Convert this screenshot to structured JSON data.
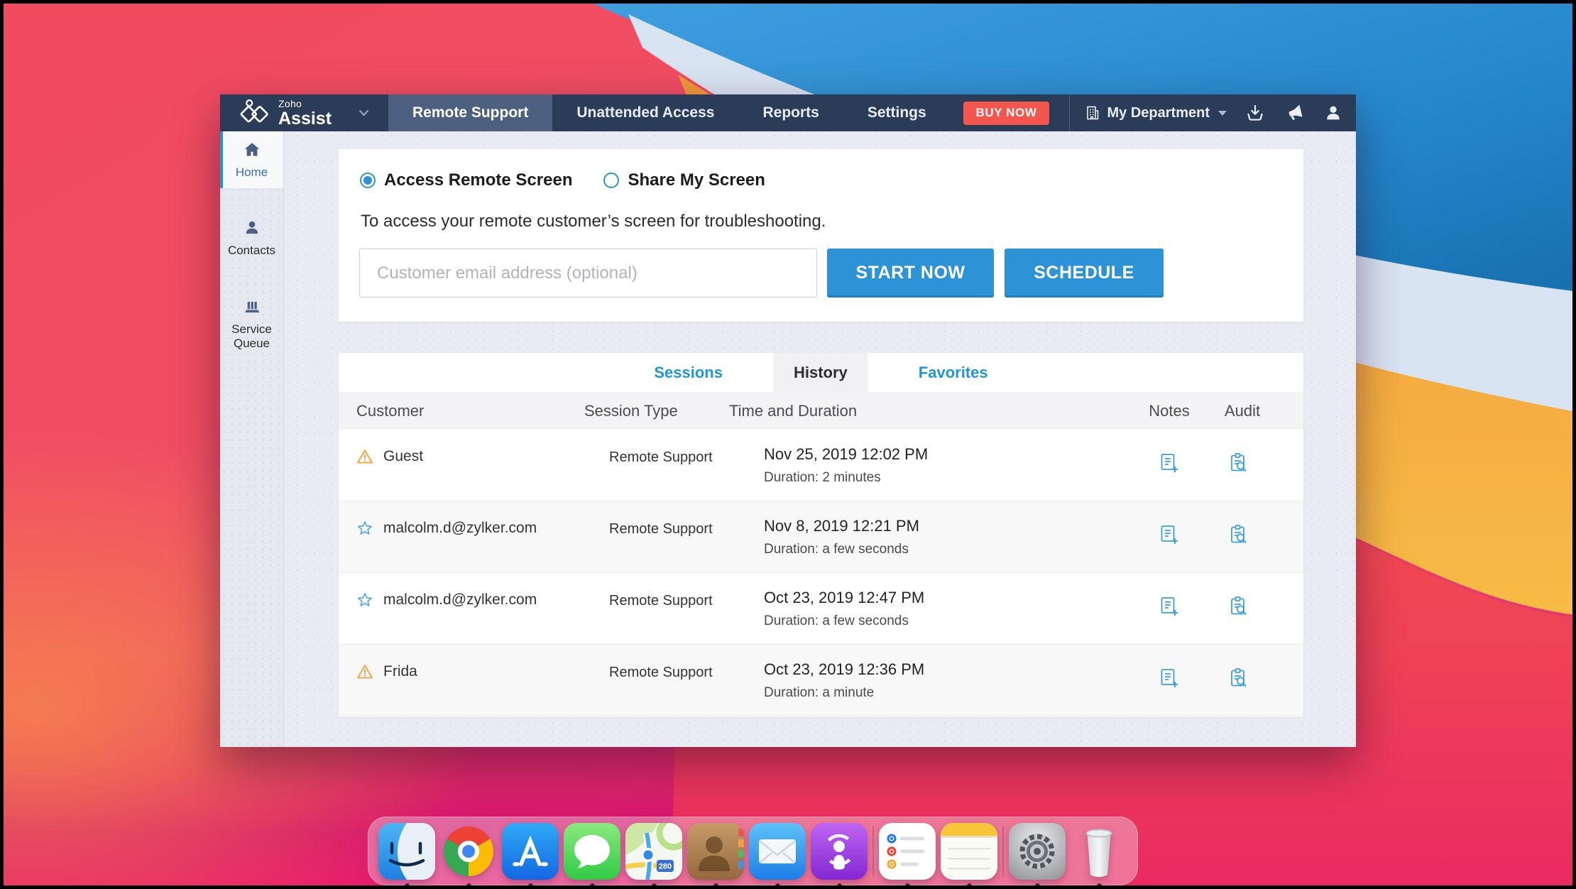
{
  "colors": {
    "navbar": "#2b3c59",
    "accent_blue": "#2d93d6",
    "link_blue": "#2196d3",
    "buy_now_red": "#f2564d",
    "warning_orange": "#f0a23f",
    "star_blue": "#4aa3e6"
  },
  "navbar": {
    "logo": {
      "brand_top": "Zoho",
      "brand_bottom": "Assist"
    },
    "tabs": [
      {
        "label": "Remote Support",
        "active": true
      },
      {
        "label": "Unattended Access",
        "active": false
      },
      {
        "label": "Reports",
        "active": false
      },
      {
        "label": "Settings",
        "active": false
      }
    ],
    "buy_now_label": "BUY NOW",
    "department_label": "My Department"
  },
  "sidebar": {
    "items": [
      {
        "label": "Home",
        "active": true
      },
      {
        "label": "Contacts",
        "active": false
      },
      {
        "label": "Service Queue",
        "active": false
      }
    ]
  },
  "session_launcher": {
    "radio_options": [
      {
        "label": "Access Remote Screen",
        "selected": true
      },
      {
        "label": "Share My Screen",
        "selected": false
      }
    ],
    "description": "To access your remote customer’s screen for troubleshooting.",
    "email_placeholder": "Customer email address (optional)",
    "start_button": "START NOW",
    "schedule_button": "SCHEDULE"
  },
  "sessions_panel": {
    "tabs": [
      {
        "label": "Sessions",
        "active": false
      },
      {
        "label": "History",
        "active": true
      },
      {
        "label": "Favorites",
        "active": false
      }
    ],
    "columns": [
      "Customer",
      "Session Type",
      "Time and Duration",
      "Notes",
      "Audit"
    ],
    "rows": [
      {
        "customer": "Guest",
        "icon": "warning",
        "session_type": "Remote Support",
        "time": "Nov 25, 2019 12:02 PM",
        "duration": "Duration: 2 minutes"
      },
      {
        "customer": "malcolm.d@zylker.com",
        "icon": "star",
        "session_type": "Remote Support",
        "time": "Nov 8, 2019 12:21 PM",
        "duration": "Duration: a few seconds"
      },
      {
        "customer": "malcolm.d@zylker.com",
        "icon": "star",
        "session_type": "Remote Support",
        "time": "Oct 23, 2019 12:47 PM",
        "duration": "Duration: a few seconds"
      },
      {
        "customer": "Frida",
        "icon": "warning",
        "session_type": "Remote Support",
        "time": "Oct 23, 2019 12:36 PM",
        "duration": "Duration: a minute"
      }
    ]
  },
  "dock": {
    "maps_badge": "280",
    "apps": [
      "finder",
      "chrome",
      "app-store",
      "messages",
      "maps",
      "contacts",
      "mail",
      "podcasts",
      "|",
      "reminders",
      "notes",
      "|",
      "system-preferences",
      "trash"
    ]
  }
}
